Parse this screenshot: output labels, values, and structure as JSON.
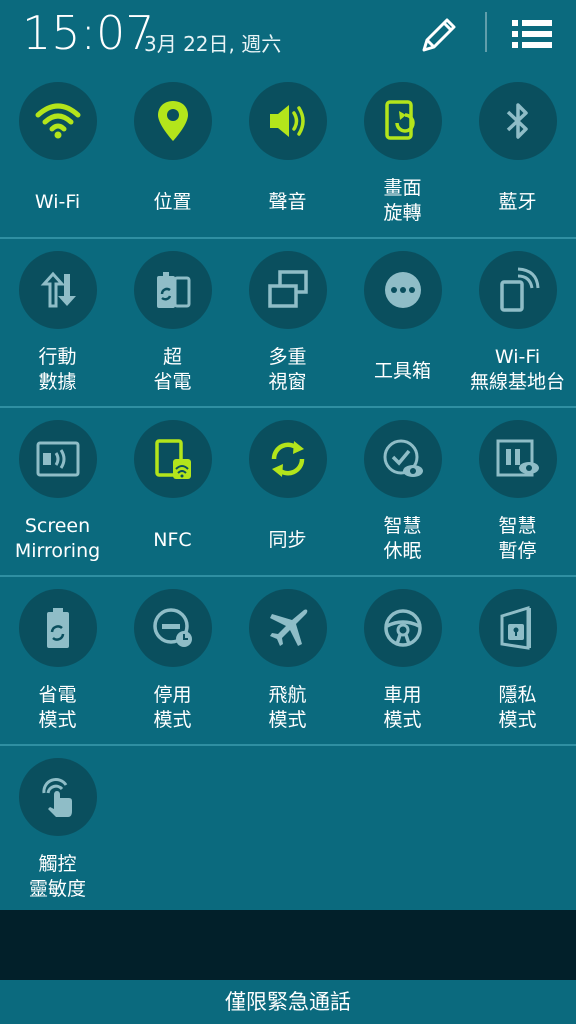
{
  "header": {
    "time": "15:07",
    "date": "3月 22日, 週六",
    "edit_icon": "pencil-icon",
    "list_icon": "list-icon"
  },
  "colors": {
    "background": "#0b6a7e",
    "circle": "#0a4f5e",
    "active": "#b3e51b",
    "inactive": "#8fbdc7",
    "bottom_bar": "#02202a"
  },
  "tiles": [
    {
      "label": "Wi-Fi",
      "icon": "wifi-icon",
      "active": true
    },
    {
      "label": "位置",
      "icon": "location-pin-icon",
      "active": true
    },
    {
      "label": "聲音",
      "icon": "speaker-icon",
      "active": true
    },
    {
      "label": "畫面\n旋轉",
      "icon": "screen-rotation-icon",
      "active": true
    },
    {
      "label": "藍牙",
      "icon": "bluetooth-icon",
      "active": false
    },
    {
      "label": "行動\n數據",
      "icon": "mobile-data-icon",
      "active": false
    },
    {
      "label": "超\n省電",
      "icon": "ultra-power-saving-icon",
      "active": false
    },
    {
      "label": "多重\n視窗",
      "icon": "multi-window-icon",
      "active": false
    },
    {
      "label": "工具箱",
      "icon": "toolbox-icon",
      "active": false
    },
    {
      "label": "Wi-Fi\n無線基地台",
      "icon": "wifi-hotspot-icon",
      "active": false
    },
    {
      "label": "Screen\nMirroring",
      "icon": "screen-mirroring-icon",
      "active": false
    },
    {
      "label": "NFC",
      "icon": "nfc-icon",
      "active": true
    },
    {
      "label": "同步",
      "icon": "sync-icon",
      "active": true
    },
    {
      "label": "智慧\n休眠",
      "icon": "smart-stay-icon",
      "active": false
    },
    {
      "label": "智慧\n暫停",
      "icon": "smart-pause-icon",
      "active": false
    },
    {
      "label": "省電\n模式",
      "icon": "power-saving-icon",
      "active": false
    },
    {
      "label": "停用\n模式",
      "icon": "blocking-mode-icon",
      "active": false
    },
    {
      "label": "飛航\n模式",
      "icon": "airplane-icon",
      "active": false
    },
    {
      "label": "車用\n模式",
      "icon": "steering-wheel-icon",
      "active": false
    },
    {
      "label": "隱私\n模式",
      "icon": "private-mode-icon",
      "active": false
    },
    {
      "label": "觸控\n靈敏度",
      "icon": "touch-sensitivity-icon",
      "active": false
    }
  ],
  "emergency_text": "僅限緊急通話"
}
